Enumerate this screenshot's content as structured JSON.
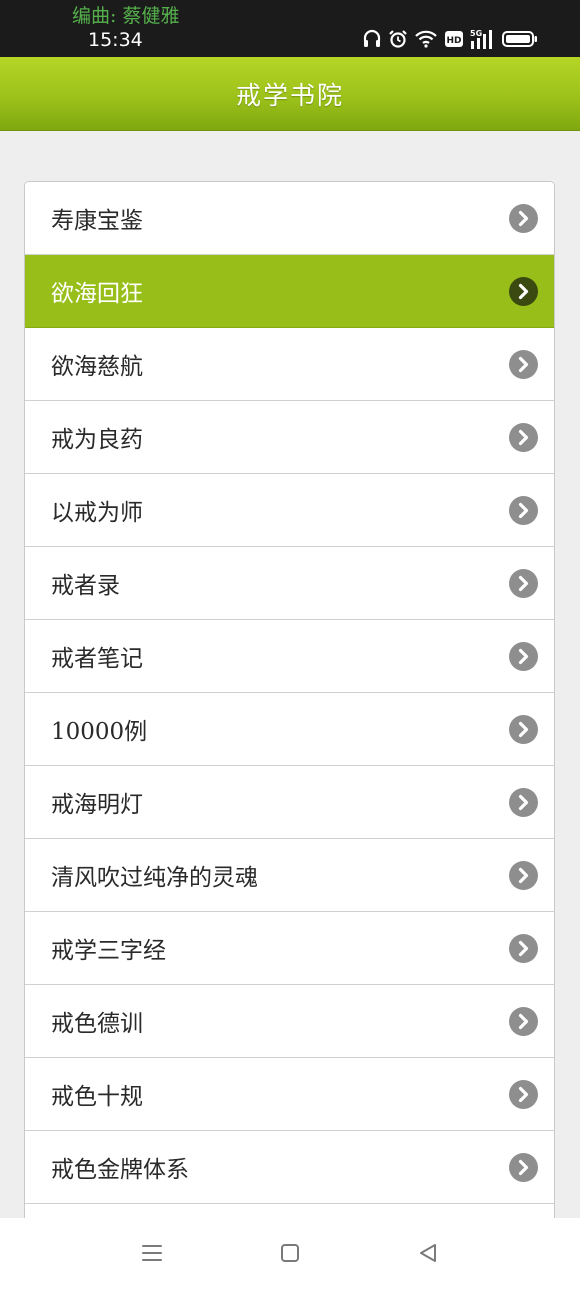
{
  "status_bar": {
    "watermark": "编曲: 蔡健雅",
    "time": "15:34",
    "icons": [
      "headphones-icon",
      "alarm-icon",
      "wifi-icon",
      "hd-icon",
      "signal-5g-icon",
      "battery-icon"
    ],
    "hd_label": "HD",
    "network_label": "5G"
  },
  "header": {
    "title": "戒学书院"
  },
  "list": {
    "items": [
      {
        "label": "寿康宝鉴",
        "active": false
      },
      {
        "label": "欲海回狂",
        "active": true
      },
      {
        "label": "欲海慈航",
        "active": false
      },
      {
        "label": "戒为良药",
        "active": false
      },
      {
        "label": "以戒为师",
        "active": false
      },
      {
        "label": "戒者录",
        "active": false
      },
      {
        "label": "戒者笔记",
        "active": false
      },
      {
        "label": "10000例",
        "active": false
      },
      {
        "label": "戒海明灯",
        "active": false
      },
      {
        "label": "清风吹过纯净的灵魂",
        "active": false
      },
      {
        "label": "戒学三字经",
        "active": false
      },
      {
        "label": "戒色德训",
        "active": false
      },
      {
        "label": "戒色十规",
        "active": false
      },
      {
        "label": "戒色金牌体系",
        "active": false
      }
    ]
  },
  "nav_bar": {
    "buttons": [
      "menu-icon",
      "home-icon",
      "back-icon"
    ]
  },
  "colors": {
    "accent": "#98be1a",
    "status_bar_bg": "#1b1b1b",
    "watermark": "#55b04c",
    "chevron": "#8e8e8e",
    "chevron_active": "#3b4a10"
  }
}
